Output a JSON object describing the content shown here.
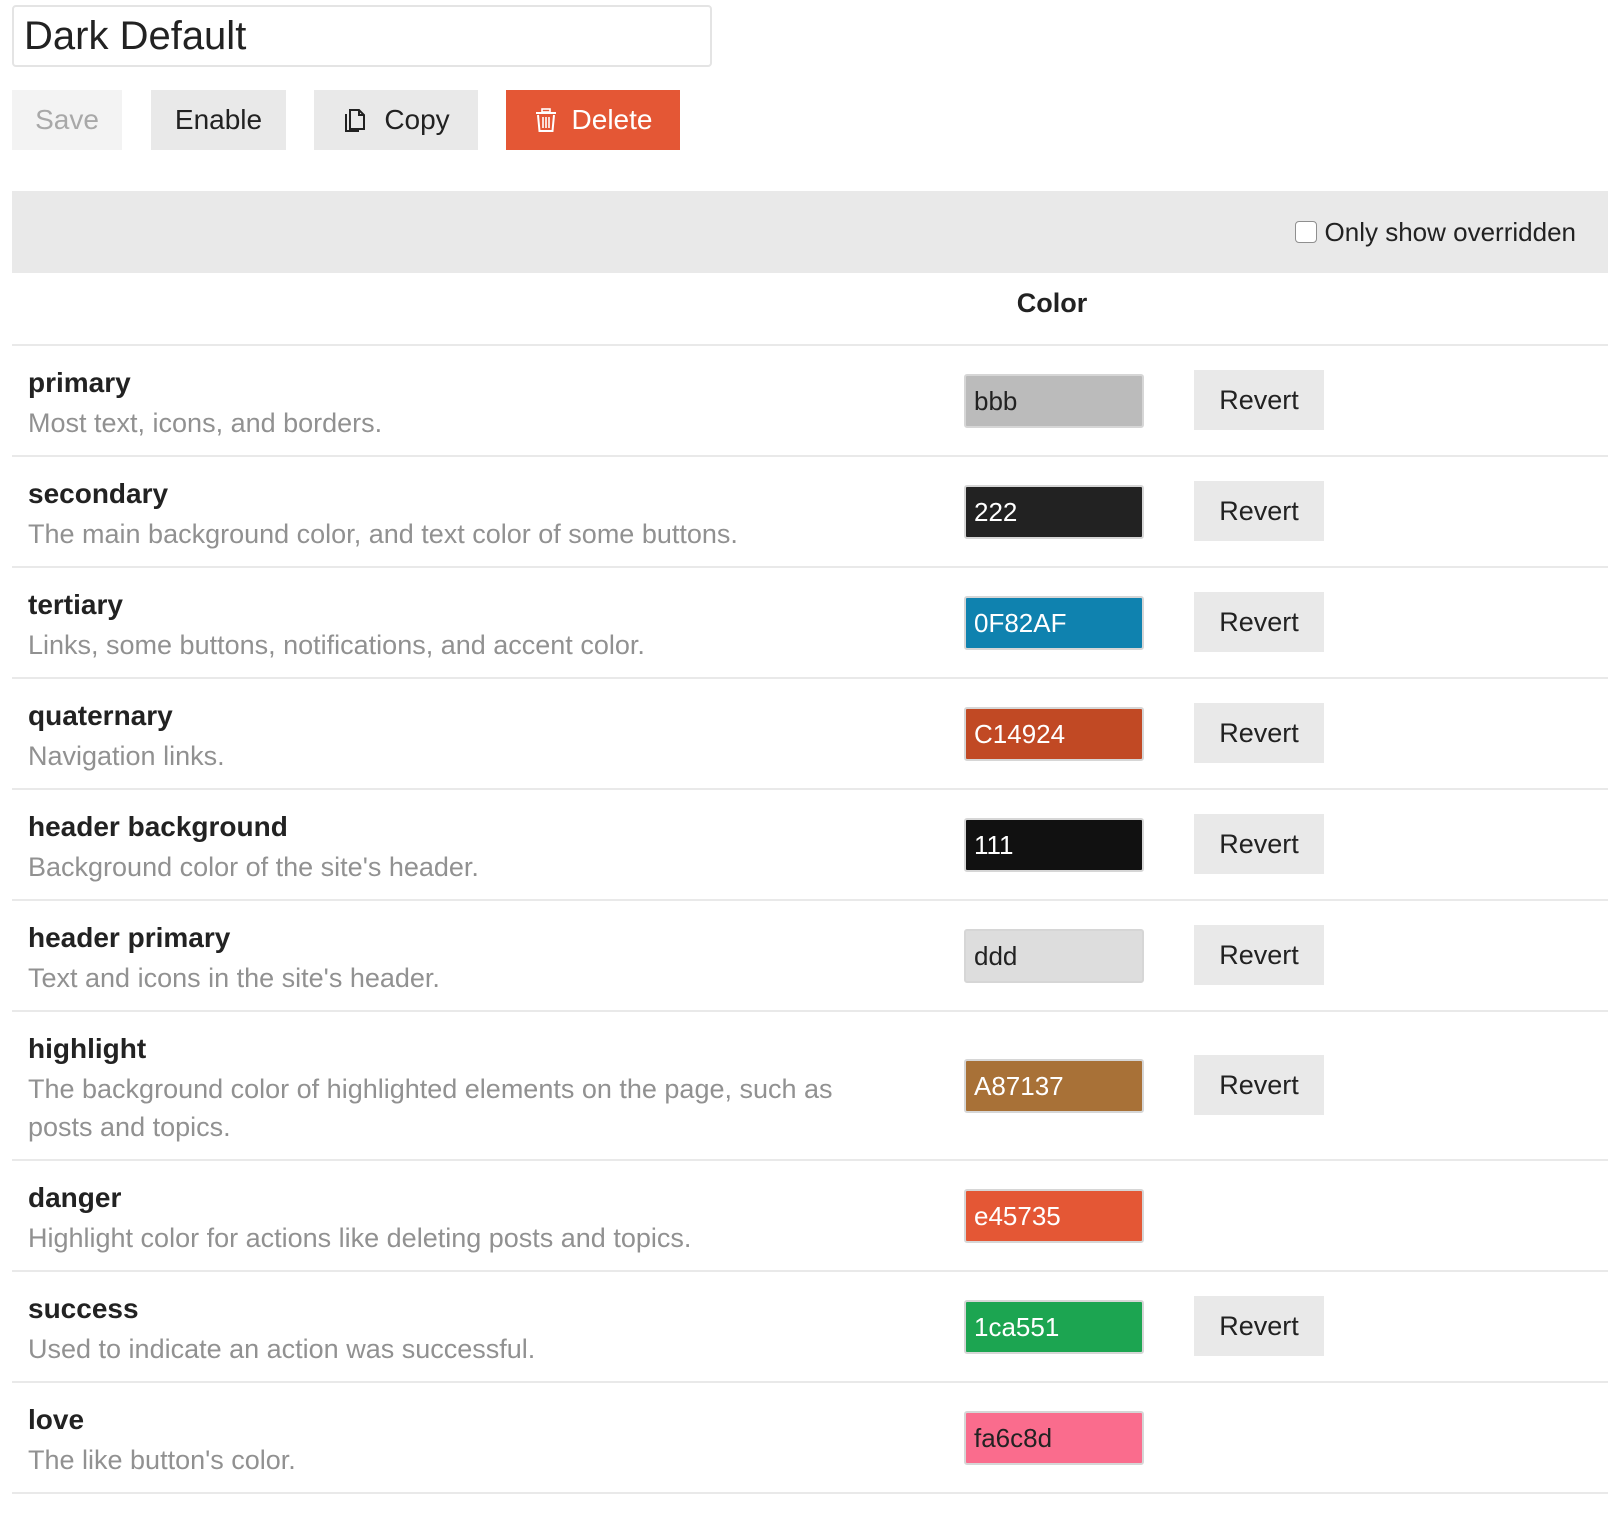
{
  "scheme": {
    "name": "Dark Default"
  },
  "toolbar": {
    "save_label": "Save",
    "enable_label": "Enable",
    "copy_label": "Copy",
    "delete_label": "Delete"
  },
  "filter": {
    "only_overridden_label": "Only show overridden",
    "checked": false
  },
  "table": {
    "color_header": "Color"
  },
  "colors": [
    {
      "name": "primary",
      "description": "Most text, icons, and borders.",
      "value": "bbb",
      "hex": "#bbbbbb",
      "text_color": "#222222",
      "revert_label": "Revert"
    },
    {
      "name": "secondary",
      "description": "The main background color, and text color of some buttons.",
      "value": "222",
      "hex": "#222222",
      "text_color": "#ffffff",
      "revert_label": "Revert"
    },
    {
      "name": "tertiary",
      "description": "Links, some buttons, notifications, and accent color.",
      "value": "0F82AF",
      "hex": "#0f82af",
      "text_color": "#ffffff",
      "revert_label": "Revert"
    },
    {
      "name": "quaternary",
      "description": "Navigation links.",
      "value": "C14924",
      "hex": "#c14924",
      "text_color": "#ffffff",
      "revert_label": "Revert"
    },
    {
      "name": "header background",
      "description": "Background color of the site's header.",
      "value": "111",
      "hex": "#111111",
      "text_color": "#ffffff",
      "revert_label": "Revert"
    },
    {
      "name": "header primary",
      "description": "Text and icons in the site's header.",
      "value": "ddd",
      "hex": "#dddddd",
      "text_color": "#222222",
      "revert_label": "Revert"
    },
    {
      "name": "highlight",
      "description": "The background color of highlighted elements on the page, such as posts and topics.",
      "value": "A87137",
      "hex": "#a87137",
      "text_color": "#ffffff",
      "revert_label": "Revert"
    },
    {
      "name": "danger",
      "description": "Highlight color for actions like deleting posts and topics.",
      "value": "e45735",
      "hex": "#e45735",
      "text_color": "#ffffff",
      "revert_label": ""
    },
    {
      "name": "success",
      "description": "Used to indicate an action was successful.",
      "value": "1ca551",
      "hex": "#1ca551",
      "text_color": "#ffffff",
      "revert_label": "Revert"
    },
    {
      "name": "love",
      "description": "The like button's color.",
      "value": "fa6c8d",
      "hex": "#fa6c8d",
      "text_color": "#222222",
      "revert_label": ""
    }
  ],
  "theme_colors": {
    "delete": "#e45735",
    "button_bg": "#e9e9e9",
    "muted_text": "#919191"
  },
  "icons": {
    "copy": "copy-icon",
    "delete": "trash-icon"
  }
}
